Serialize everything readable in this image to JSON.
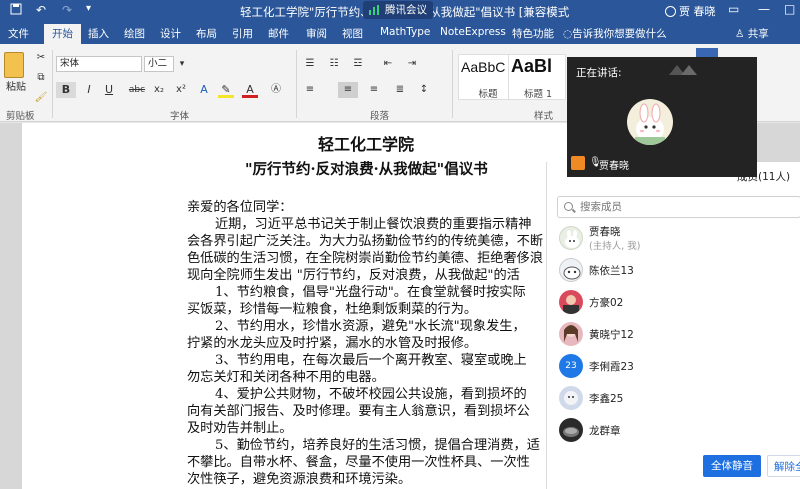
{
  "titlebar": {
    "save_icon": "save-icon",
    "undo_icon": "undo-icon",
    "redo_icon": "redo-icon",
    "title": "轻工化工学院\"厉行节约、反对浪费、从我做起\"倡议书 [兼容模式] - Word",
    "meeting_label": "腾讯会议",
    "user": "贾 春晓",
    "accent": "#2b579a"
  },
  "tabs": [
    "文件",
    "开始",
    "插入",
    "绘图",
    "设计",
    "布局",
    "引用",
    "邮件",
    "审阅",
    "视图",
    "MathType",
    "NoteExpress",
    "特色功能"
  ],
  "tell_me": "告诉我你想要做什么",
  "share": "共享",
  "ribbon": {
    "paste": "粘贴",
    "clipboard": "剪贴板",
    "font_name": "宋体",
    "font_size": "小二",
    "font_group": "字体",
    "paragraph_group": "段落",
    "styles_group": "样式",
    "styles": [
      {
        "sample": "AaBbC",
        "caption": "标题"
      },
      {
        "sample": "AaBl",
        "caption": "标题 1"
      }
    ],
    "bold": "B",
    "italic": "I",
    "underline": "U",
    "strike": "abc",
    "sub": "x₂",
    "sup": "x²"
  },
  "document": {
    "title": "轻工化工学院",
    "subtitle": "\"厉行节约·反对浪费·从我做起\"倡议书",
    "lines": [
      "亲爱的各位同学：",
      "近期，习近平总书记关于制止餐饮浪费的重要指示精神",
      "会各界引起广泛关注。为大力弘扬勤俭节约的传统美德，不断",
      "色低碳的生活习惯，在全院树崇尚勤俭节约美德、拒绝奢侈浪",
      "现向全院师生发出 \"厉行节约，反对浪费，从我做起\"的活",
      "1、节约粮食，倡导\"光盘行动\"。在食堂就餐时按实际",
      "买饭菜，珍惜每一粒粮食，杜绝剩饭剩菜的行为。",
      "2、节约用水，珍惜水资源，避免\"水长流\"现象发生，",
      "拧紧的水龙头应及时拧紧，漏水的水管及时报修。",
      "3、节约用电，在每次最后一个离开教室、寝室或晚上",
      "勿忘关灯和关闭各种不用的电器。",
      "4、爱护公共财物，不破坏校园公共设施，看到损坏的",
      "向有关部门报告、及时修理。要有主人翁意识，看到损坏公",
      "及时劝告并制止。",
      "5、勤俭节约，培养良好的生活习惯，提倡合理消费，适",
      "不攀比。自带水杯、餐盒，尽量不使用一次性杯具、一次性",
      "次性筷子，避免资源浪费和环境污染。"
    ]
  },
  "video": {
    "speaking_label": "正在讲话:",
    "speaker": "贾春晓"
  },
  "members": {
    "title_partial": "成员(11人)",
    "search_placeholder": "搜索成员",
    "list": [
      {
        "name": "贾春晓",
        "sub": "(主持人, 我)",
        "color": "#e9efe4"
      },
      {
        "name": "陈依兰13",
        "sub": "",
        "color": "#eef2f6"
      },
      {
        "name": "方豪02",
        "sub": "",
        "color": "#d94a5c"
      },
      {
        "name": "黄晓宁12",
        "sub": "",
        "color": "#e7b9bf"
      },
      {
        "name": "李俐霞23",
        "sub": "",
        "color": "#1e78e6",
        "badge": "23"
      },
      {
        "name": "李鑫25",
        "sub": "",
        "color": "#cfd9ea"
      },
      {
        "name": "龙群章",
        "sub": "",
        "color": "#2a2a2a"
      }
    ],
    "mute_all": "全体静音",
    "unmute_all": "解除全体静音"
  }
}
